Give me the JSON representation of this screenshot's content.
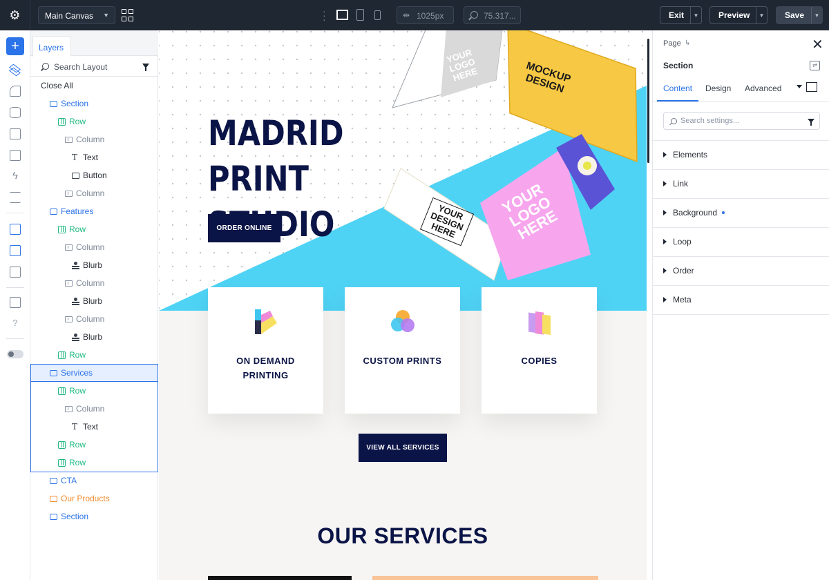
{
  "topbar": {
    "canvas_select": "Main Canvas",
    "width_value": "1025px",
    "zoom_value": "75.317...",
    "exit_label": "Exit",
    "preview_label": "Preview",
    "save_label": "Save"
  },
  "layers": {
    "tab_label": "Layers",
    "search_placeholder": "Search Layout",
    "close_all": "Close All",
    "items": [
      {
        "label": "Section",
        "type": "section"
      },
      {
        "label": "Row",
        "type": "row"
      },
      {
        "label": "Column",
        "type": "column"
      },
      {
        "label": "Text",
        "type": "text"
      },
      {
        "label": "Button",
        "type": "button"
      },
      {
        "label": "Column",
        "type": "column"
      },
      {
        "label": "Features",
        "type": "section"
      },
      {
        "label": "Row",
        "type": "row"
      },
      {
        "label": "Column",
        "type": "column"
      },
      {
        "label": "Blurb",
        "type": "blurb"
      },
      {
        "label": "Column",
        "type": "column"
      },
      {
        "label": "Blurb",
        "type": "blurb"
      },
      {
        "label": "Column",
        "type": "column"
      },
      {
        "label": "Blurb",
        "type": "blurb"
      },
      {
        "label": "Row",
        "type": "row"
      },
      {
        "label": "Services",
        "type": "section"
      },
      {
        "label": "Row",
        "type": "row"
      },
      {
        "label": "Column",
        "type": "column"
      },
      {
        "label": "Text",
        "type": "text"
      },
      {
        "label": "Row",
        "type": "row"
      },
      {
        "label": "Row",
        "type": "row"
      },
      {
        "label": "CTA",
        "type": "section"
      },
      {
        "label": "Our Products",
        "type": "section-orange"
      },
      {
        "label": "Section",
        "type": "section"
      }
    ]
  },
  "canvas": {
    "hero_title_line1": "MADRID PRINT",
    "hero_title_line2": "STUDIO",
    "order_button": "ORDER ONLINE",
    "card1_line1": "ON DEMAND",
    "card1_line2": "PRINTING",
    "card2_title": "CUSTOM PRINTS",
    "card3_title": "COPIES",
    "view_button": "VIEW ALL SERVICES",
    "our_services": "OUR SERVICES",
    "mockup_text1": "YOUR",
    "mockup_text2": "LOGO",
    "mockup_text3": "HERE",
    "mockup_design1": "MOCKUP",
    "mockup_design2": "DESIGN",
    "mockup_design3": "DESIGN",
    "colors": {
      "navy": "#0b1446",
      "cyan": "#4fd3f5",
      "yellow": "#f7c844",
      "pink": "#f7a6ee",
      "purple": "#5b53d6"
    }
  },
  "settings": {
    "breadcrumb": "Page",
    "section_title": "Section",
    "tabs": [
      "Content",
      "Design",
      "Advanced"
    ],
    "search_placeholder": "Search settings...",
    "groups": [
      "Elements",
      "Link",
      "Background",
      "Loop",
      "Order",
      "Meta"
    ]
  },
  "colors": {
    "accent": "#2b73e8",
    "topbar": "#1f2733",
    "row_green": "#20b981",
    "products_orange": "#ef8a2c"
  }
}
